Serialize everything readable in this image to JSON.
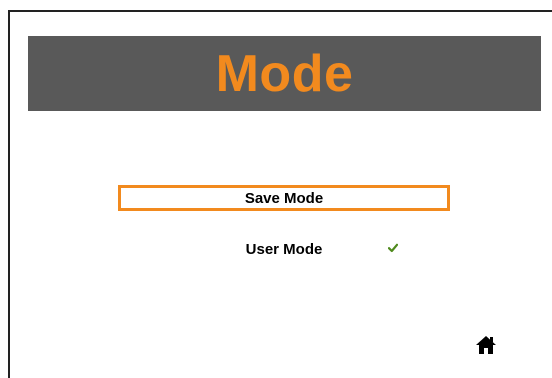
{
  "header": {
    "title": "Mode"
  },
  "menu": {
    "items": [
      {
        "label": "Save Mode",
        "selected": true
      },
      {
        "label": "User Mode",
        "checked": true
      }
    ]
  },
  "icons": {
    "check": "checkmark-icon",
    "home": "home-icon"
  },
  "colors": {
    "accent": "#f28a1e",
    "header_background": "#595959",
    "check": "#4f8a1d"
  }
}
